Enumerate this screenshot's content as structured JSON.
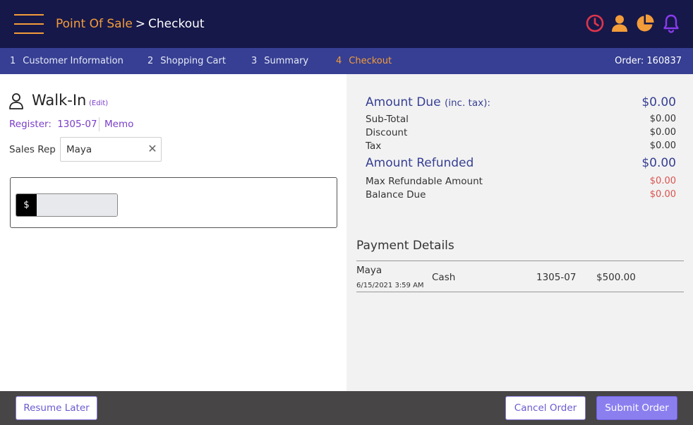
{
  "header": {
    "app_name": "Point Of Sale",
    "separator": ">",
    "page_name": "Checkout",
    "icons": [
      {
        "name": "clock-icon",
        "color": "#e0354b"
      },
      {
        "name": "user-icon",
        "color": "#f39c3a"
      },
      {
        "name": "pie-chart-icon",
        "color": "#f39c3a"
      },
      {
        "name": "bell-icon",
        "color": "#8a3bf0"
      }
    ]
  },
  "steps": [
    {
      "num": "1",
      "label": "Customer Information"
    },
    {
      "num": "2",
      "label": "Shopping Cart"
    },
    {
      "num": "3",
      "label": "Summary"
    },
    {
      "num": "4",
      "label": "Checkout"
    }
  ],
  "order": {
    "label": "Order: 160837"
  },
  "customer": {
    "name": "Walk-In",
    "edit_label": "(Edit)",
    "register_label": "Register:",
    "register_value": "1305-07",
    "memo_label": "Memo",
    "sales_rep_label": "Sales Rep",
    "sales_rep_value": "Maya",
    "clear_glyph": "✕"
  },
  "payment_input": {
    "currency_symbol": "$",
    "amount_value": ""
  },
  "totals": {
    "amount_due_label": "Amount Due",
    "amount_due_suffix": "(inc. tax):",
    "amount_due_value": "$0.00",
    "subtotal_label": "Sub-Total",
    "subtotal_value": "$0.00",
    "discount_label": "Discount",
    "discount_value": "$0.00",
    "tax_label": "Tax",
    "tax_value": "$0.00",
    "refunded_label": "Amount Refunded",
    "refunded_value": "$0.00",
    "max_refundable_label": "Max Refundable Amount",
    "max_refundable_value": "$0.00",
    "balance_due_label": "Balance Due",
    "balance_due_value": "$0.00"
  },
  "payment_details": {
    "title": "Payment Details",
    "rows": [
      {
        "name": "Maya",
        "date": "6/15/2021 3:59 AM",
        "method": "Cash",
        "register": "1305-07",
        "amount": "$500.00"
      }
    ]
  },
  "footer": {
    "resume_label": "Resume Later",
    "cancel_label": "Cancel Order",
    "submit_label": "Submit Order"
  }
}
